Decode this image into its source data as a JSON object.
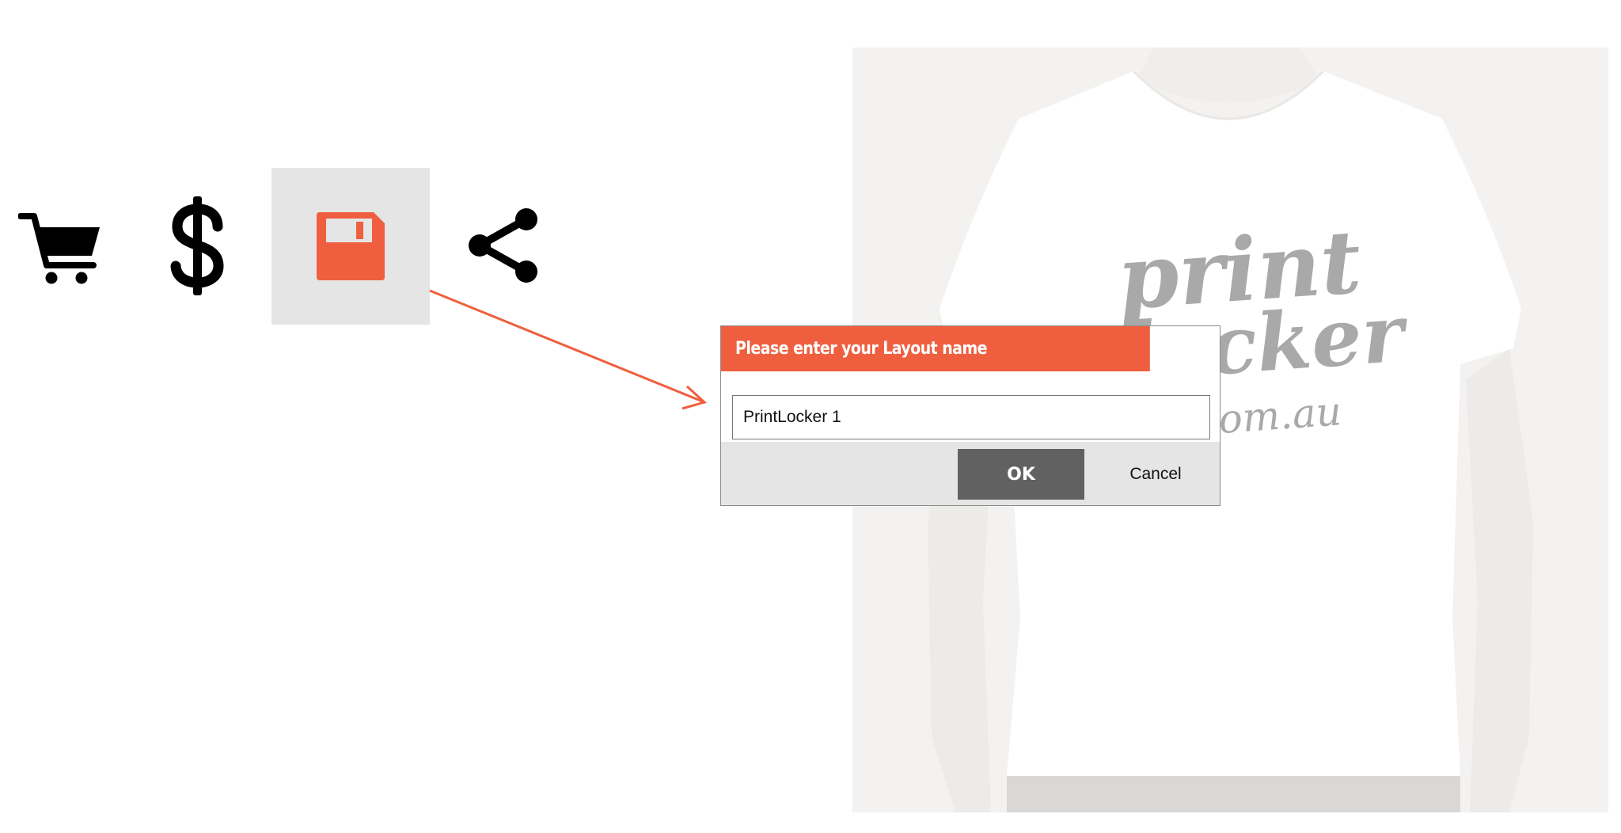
{
  "toolbar": {
    "icons": [
      "cart-icon",
      "dollar-icon",
      "save-icon",
      "share-icon"
    ],
    "active": "save-icon"
  },
  "preview": {
    "logo_text": [
      "print",
      "locker",
      ".com.au"
    ]
  },
  "dialog": {
    "title": "Please enter your Layout name",
    "input_value": "PrintLocker 1",
    "ok_label": "OK",
    "cancel_label": "Cancel"
  },
  "colors": {
    "accent": "#ef5f3f",
    "active_bg": "#e5e5e5",
    "ok_bg": "#616161",
    "preview_bg": "#f3f2f0"
  }
}
